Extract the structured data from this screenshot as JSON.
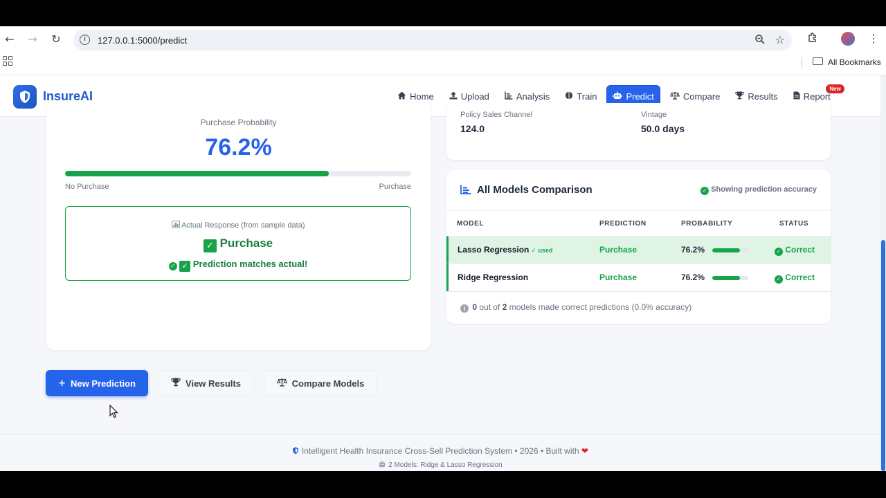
{
  "browser": {
    "url": "127.0.0.1:5000/predict",
    "bookmarks_label": "All Bookmarks"
  },
  "nav": {
    "brand": "InsureAI",
    "items": [
      {
        "label": "Home",
        "icon": "home-icon"
      },
      {
        "label": "Upload",
        "icon": "upload-icon"
      },
      {
        "label": "Analysis",
        "icon": "chart-icon"
      },
      {
        "label": "Train",
        "icon": "brain-icon"
      },
      {
        "label": "Predict",
        "icon": "robot-icon",
        "active": true
      },
      {
        "label": "Compare",
        "icon": "scale-icon"
      },
      {
        "label": "Results",
        "icon": "trophy-icon"
      },
      {
        "label": "Report",
        "icon": "document-icon",
        "badge": "New"
      }
    ],
    "accent": "#2563eb"
  },
  "prediction": {
    "probability_label": "Purchase Probability",
    "probability_value": "76.2%",
    "probability_fraction": 0.762,
    "bar_left_label": "No Purchase",
    "bar_right_label": "Purchase",
    "actual_label": "Actual Response (from sample data)",
    "actual_value": "Purchase",
    "match_text": "Prediction matches actual!"
  },
  "inputs": {
    "fields": [
      {
        "label": "Policy Sales Channel",
        "value": "124.0"
      },
      {
        "label": "Vintage",
        "value": "50.0 days"
      }
    ]
  },
  "comparison": {
    "title": "All Models Comparison",
    "note": "Showing prediction accuracy",
    "columns": [
      "MODEL",
      "PREDICTION",
      "PROBABILITY",
      "STATUS"
    ],
    "rows": [
      {
        "model": "Lasso Regression",
        "tag": "✓ used",
        "prediction": "Purchase",
        "probability": "76.2%",
        "fraction": 0.762,
        "status": "Correct"
      },
      {
        "model": "Ridge Regression",
        "tag": "",
        "prediction": "Purchase",
        "probability": "76.2%",
        "fraction": 0.762,
        "status": "Correct"
      }
    ],
    "summary": {
      "correct": "0",
      "mid": " out of ",
      "total": "2",
      "rest": " models made correct predictions (0.0% accuracy)"
    }
  },
  "actions": {
    "new_prediction": "New Prediction",
    "view_results": "View Results",
    "compare_models": "Compare Models"
  },
  "footer": {
    "line1": "Intelligent Health Insurance Cross-Sell Prediction System • 2026 • Built with",
    "line2": "2 Models: Ridge & Lasso Regression"
  },
  "colors": {
    "success": "#16a34a",
    "primary": "#2563eb",
    "badge": "#dc2626"
  }
}
